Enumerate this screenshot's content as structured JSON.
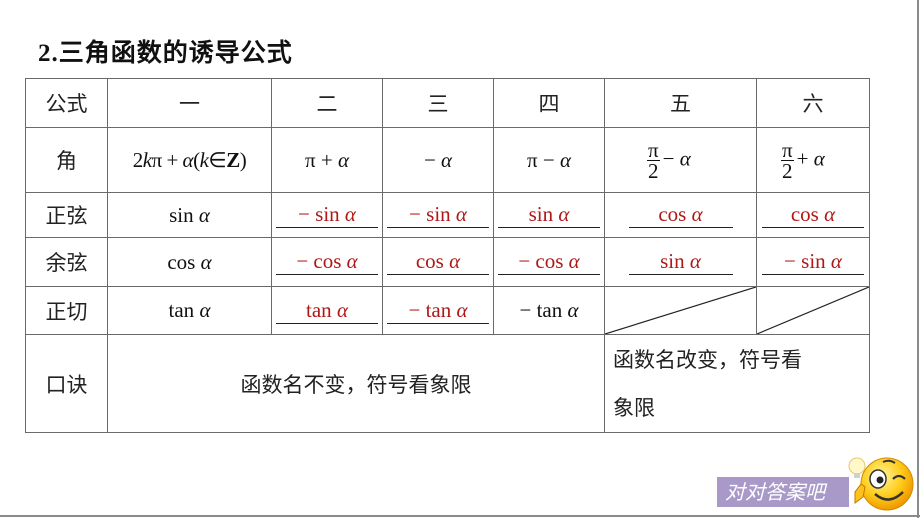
{
  "title": {
    "number": "2.",
    "text": "三角函数的诱导公式"
  },
  "table": {
    "header": [
      "公式",
      "一",
      "二",
      "三",
      "四",
      "五",
      "六"
    ],
    "angle_row": {
      "label": "角",
      "cells": [
        {
          "parts": [
            "2",
            "k",
            "π + ",
            "α",
            "(",
            "k",
            "∈",
            "Z",
            ")"
          ]
        },
        {
          "text_a": "π + ",
          "text_b": "α"
        },
        {
          "text_a": "− ",
          "text_b": "α"
        },
        {
          "text_a": "π − ",
          "text_b": "α"
        },
        {
          "frac_num": "π",
          "frac_den": "2",
          "op": "− ",
          "var": "α"
        },
        {
          "frac_num": "π",
          "frac_den": "2",
          "op": "+ ",
          "var": "α"
        }
      ]
    },
    "rows": [
      {
        "label": "正弦",
        "given": {
          "fn": "sin ",
          "var": "α"
        },
        "answers": [
          {
            "fn": "− sin ",
            "var": "α"
          },
          {
            "fn": "− sin ",
            "var": "α"
          },
          {
            "fn": "sin ",
            "var": "α"
          },
          {
            "fn": "cos ",
            "var": "α"
          },
          {
            "fn": "cos ",
            "var": "α"
          }
        ]
      },
      {
        "label": "余弦",
        "given": {
          "fn": "cos ",
          "var": "α"
        },
        "answers": [
          {
            "fn": "− cos ",
            "var": "α"
          },
          {
            "fn": "cos ",
            "var": "α"
          },
          {
            "fn": "− cos ",
            "var": "α"
          },
          {
            "fn": "sin ",
            "var": "α"
          },
          {
            "fn": "− sin ",
            "var": "α"
          }
        ]
      },
      {
        "label": "正切",
        "given": {
          "fn": "tan ",
          "var": "α"
        },
        "answers": [
          {
            "fn": "tan ",
            "var": "α"
          },
          {
            "fn": "− tan ",
            "var": "α"
          }
        ],
        "static": {
          "fn": "− tan ",
          "var": "α"
        }
      }
    ],
    "rhyme": {
      "label": "口诀",
      "left": "函数名不变，符号看象限",
      "right_line1": "函数名改变，符号看",
      "right_line2": "象限"
    }
  },
  "badge": {
    "text": "对对答案吧",
    "icon": "winking-smiley-lightbulb-icon"
  },
  "colors": {
    "answer": "#b01818",
    "badge_bg": "#a899c9",
    "grid": "#6a6a6a"
  }
}
